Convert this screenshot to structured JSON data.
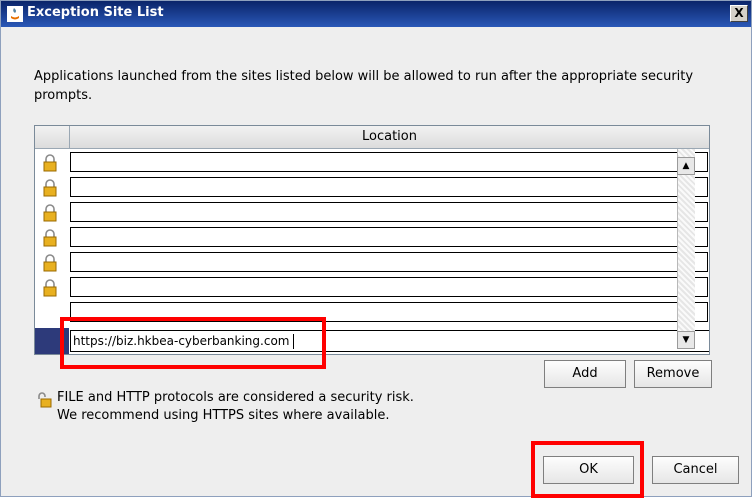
{
  "window": {
    "title": "Exception Site List",
    "close_label": "X"
  },
  "description": "Applications launched from the sites listed below will be allowed to run after the appropriate security prompts.",
  "table": {
    "column_header": "Location",
    "rows": [
      {
        "location": "",
        "icon": "padlock-icon"
      },
      {
        "location": "",
        "icon": "padlock-icon"
      },
      {
        "location": "",
        "icon": "padlock-icon"
      },
      {
        "location": "",
        "icon": "padlock-icon"
      },
      {
        "location": "",
        "icon": "padlock-icon"
      },
      {
        "location": "",
        "icon": "padlock-icon"
      },
      {
        "location": ""
      }
    ],
    "editing_row_value": "https://biz.hkbea-cyberbanking.com"
  },
  "buttons": {
    "add": "Add",
    "remove": "Remove",
    "ok": "OK",
    "cancel": "Cancel"
  },
  "warning": {
    "line1": "FILE and HTTP protocols are considered a security risk.",
    "line2": "We recommend using HTTPS sites where available."
  },
  "colors": {
    "highlight": "#ff0000",
    "selection": "#2d3a7a",
    "titlebar": "#0a246a"
  }
}
